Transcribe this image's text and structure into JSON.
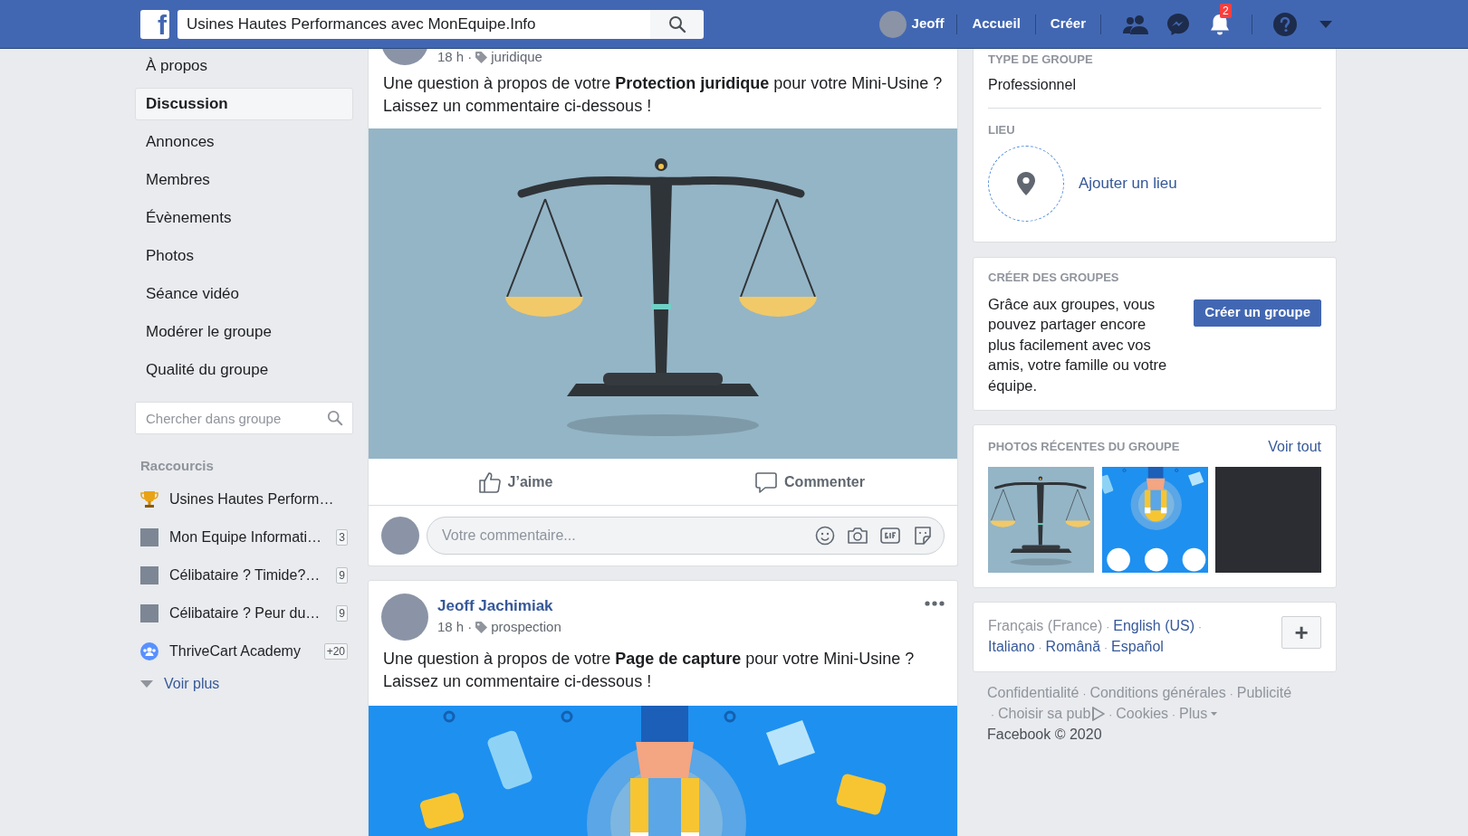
{
  "topbar": {
    "logo": "f",
    "search_value": "Usines Hautes Performances avec MonEquipe.Info",
    "user": "Jeoff",
    "links": [
      "Accueil",
      "Créer"
    ],
    "notifications_badge": "2"
  },
  "nav": [
    {
      "label": "À propos",
      "selected": false
    },
    {
      "label": "Discussion",
      "selected": true
    },
    {
      "label": "Annonces",
      "selected": false
    },
    {
      "label": "Membres",
      "selected": false
    },
    {
      "label": "Évènements",
      "selected": false
    },
    {
      "label": "Photos",
      "selected": false
    },
    {
      "label": "Séance vidéo",
      "selected": false
    },
    {
      "label": "Modérer le groupe",
      "selected": false
    },
    {
      "label": "Qualité du groupe",
      "selected": false
    }
  ],
  "group_search": {
    "placeholder": "Chercher dans groupe"
  },
  "shortcuts": {
    "title": "Raccourcis",
    "items": [
      {
        "kind": "trophy",
        "label": "Usines Hautes Perform…"
      },
      {
        "kind": "photo",
        "label": "Mon Equipe Informati…",
        "count": "3"
      },
      {
        "kind": "photo",
        "label": "Célibataire ? Timide?…",
        "count": "9"
      },
      {
        "kind": "photo",
        "label": "Célibataire ? Peur du…",
        "count": "9"
      },
      {
        "kind": "group",
        "label": "ThriveCart Academy",
        "count": "+20"
      }
    ],
    "more": "Voir plus"
  },
  "posts": [
    {
      "time": "18 h",
      "separator": "·",
      "tag": "juridique",
      "text": "Une question à propos de votre **Protection juridique** pour votre Mini-Usine ? Laissez un commentaire ci-dessous !",
      "image": {
        "kind": "scales"
      },
      "actions": [
        "J’aime",
        "Commenter"
      ],
      "comment_placeholder": "Votre commentaire..."
    },
    {
      "author": "Jeoff Jachimiak",
      "time": "18 h",
      "separator": "·",
      "tag": "prospection",
      "text": "Une question à propos de votre **Page de capture** pour votre Mini-Usine ? Laissez un commentaire ci-dessous !",
      "image": {
        "kind": "magnet"
      }
    }
  ],
  "about": {
    "type_label": "TYPE DE GROUPE",
    "type_value": "Professionnel",
    "location_label": "LIEU",
    "location_action": "Ajouter un lieu"
  },
  "create_groups": {
    "title": "CRÉER DES GROUPES",
    "text": "Grâce aux groupes, vous pouvez partager encore plus facilement avec vos amis, votre famille ou votre équipe.",
    "button": "Créer un groupe"
  },
  "recent_photos": {
    "title": "PHOTOS RÉCENTES DU GROUPE",
    "link": "Voir tout",
    "photos": [
      {
        "kind": "scales"
      },
      {
        "kind": "magnet"
      },
      {
        "kind": "photo"
      }
    ]
  },
  "languages": {
    "separator": "·",
    "items": [
      {
        "label": "Français (France)",
        "selected": true
      },
      {
        "label": "English (US)",
        "selected": false
      },
      {
        "label": "Italiano",
        "selected": false
      },
      {
        "label": "Română",
        "selected": false
      },
      {
        "label": "Español",
        "selected": false
      }
    ],
    "more_button": "+"
  },
  "footer": {
    "separator": "·",
    "links": [
      "Confidentialité",
      "Conditions générales",
      "Publicité",
      "Choisir sa pub",
      "Cookies",
      "Plus"
    ],
    "copyright": "Facebook © 2020"
  }
}
